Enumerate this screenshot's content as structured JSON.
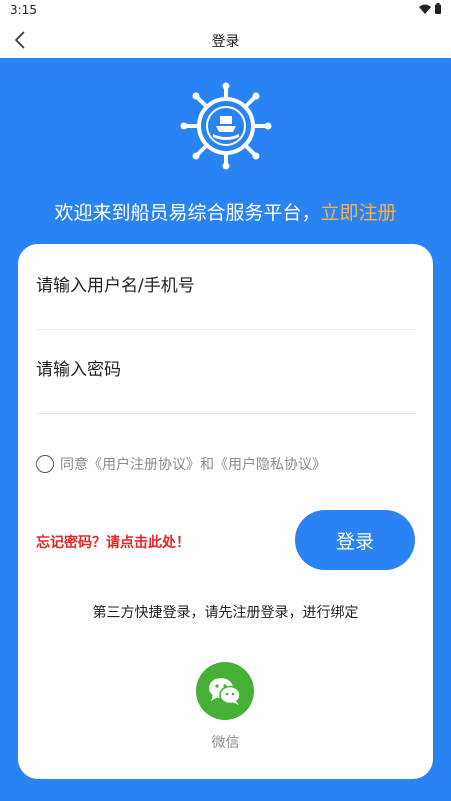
{
  "status_bar": {
    "time": "3:15"
  },
  "nav": {
    "title": "登录"
  },
  "welcome": {
    "text": "欢迎来到船员易综合服务平台，",
    "register_link": "立即注册"
  },
  "form": {
    "username_placeholder": "请输入用户名/手机号",
    "password_placeholder": "请输入密码"
  },
  "agreement": {
    "prefix": "同意",
    "user_agreement": "《用户注册协议》",
    "conjunction": " 和",
    "privacy_policy": "《用户隐私协议》"
  },
  "forgot_password": "忘记密码？请点击此处！",
  "login_button": "登录",
  "third_party": {
    "hint": "第三方快捷登录，请先注册登录，进行绑定",
    "wechat_label": "微信"
  },
  "colors": {
    "primary": "#2a83f2",
    "link_orange": "#f8b14a",
    "warning_red": "#e82525",
    "wechat_green": "#45b035"
  },
  "icons": [
    "back-arrow-icon",
    "wifi-icon",
    "battery-icon",
    "ship-wheel-logo",
    "radio-icon",
    "wechat-icon"
  ]
}
